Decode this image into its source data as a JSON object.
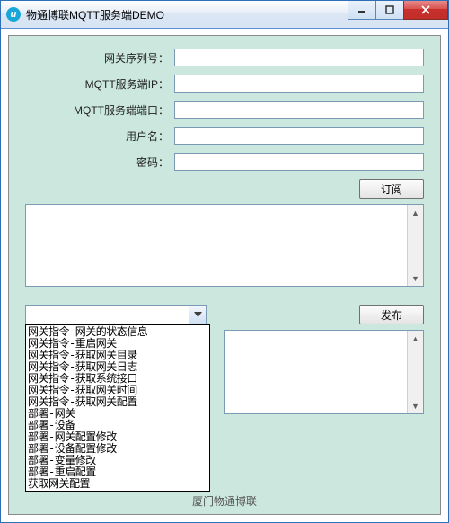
{
  "window": {
    "title": "物通博联MQTT服务端DEMO"
  },
  "form": {
    "gateway_sn_label": "网关序列号：",
    "server_ip_label": "MQTT服务端IP：",
    "server_port_label": "MQTT服务端端口：",
    "username_label": "用户名：",
    "password_label": "密码：",
    "gateway_sn": "",
    "server_ip": "",
    "server_port": "",
    "username": "",
    "password": ""
  },
  "buttons": {
    "subscribe": "订阅",
    "publish": "发布"
  },
  "combo": {
    "value": "",
    "options": [
      "网关指令-网关的状态信息",
      "网关指令-重启网关",
      "网关指令-获取网关目录",
      "网关指令-获取网关日志",
      "网关指令-获取系统接口",
      "网关指令-获取网关时间",
      "网关指令-获取网关配置",
      "部署-网关",
      "部署-设备",
      "部署-网关配置修改",
      "部署-设备配置修改",
      "部署-变量修改",
      "部署-重启配置",
      "获取网关配置"
    ]
  },
  "footer": {
    "text": "厦门物通博联"
  }
}
